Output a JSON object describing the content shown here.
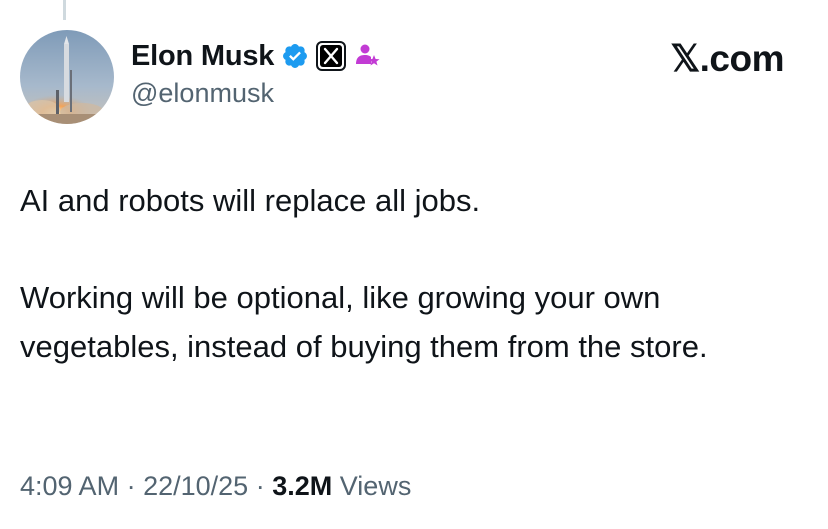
{
  "header": {
    "display_name": "Elon Musk",
    "handle": "@elonmusk",
    "site_wordmark": "𝕏.com",
    "badges": [
      "verified-badge-icon",
      "x-affiliate-badge-icon",
      "government-label-icon"
    ],
    "colors": {
      "verified": "#1d9bf0",
      "affiliate_bg": "#000000",
      "label_icon": "#c23bd4"
    }
  },
  "tweet": {
    "paragraph_1": "AI and robots will replace all jobs.",
    "paragraph_2": "Working will be optional, like growing your own vegetables, instead of buying them from the store."
  },
  "meta": {
    "time": "4:09 AM",
    "separator": "·",
    "date": "22/10/25",
    "views_count": "3.2M",
    "views_label": "Views"
  },
  "colors": {
    "text_primary": "#0f1419",
    "text_secondary": "#536471",
    "thread_line": "#cfd9de"
  }
}
